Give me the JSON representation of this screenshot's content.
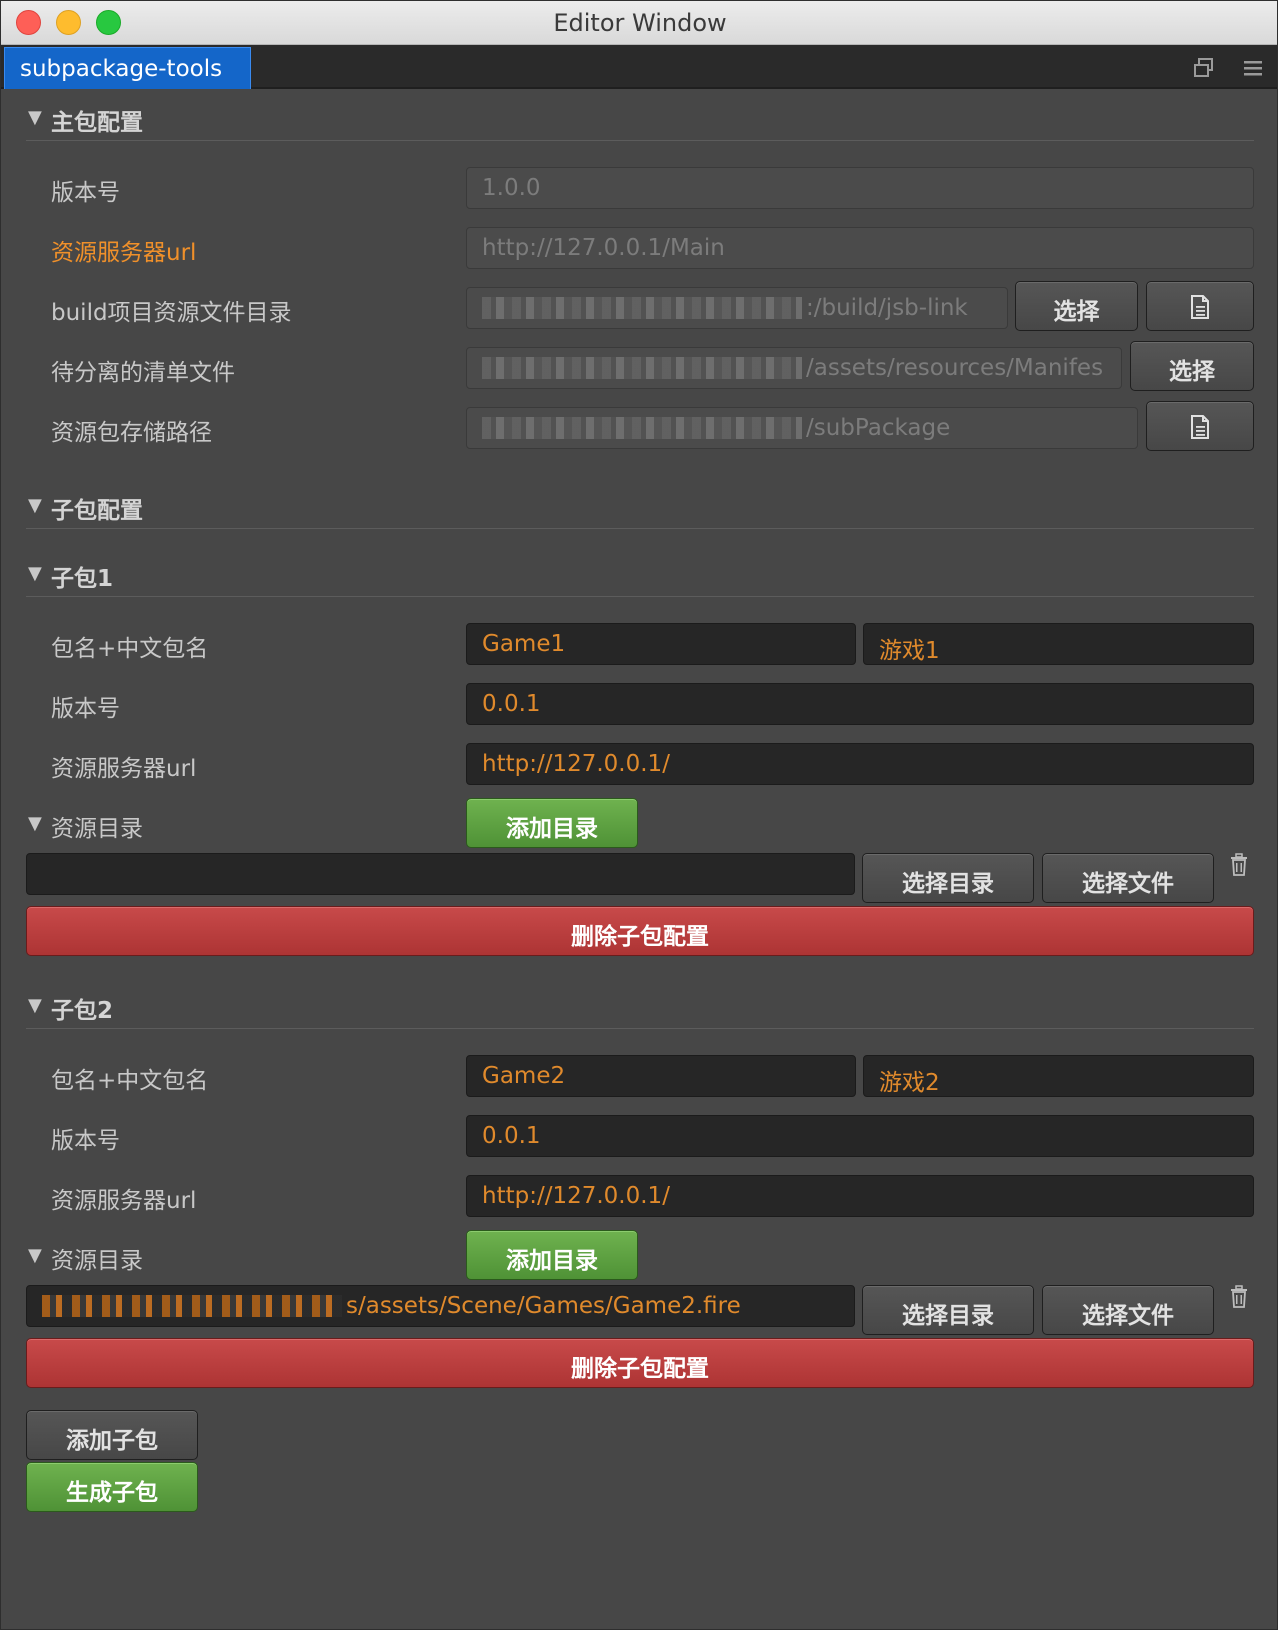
{
  "window": {
    "title": "Editor Window"
  },
  "tabbar": {
    "active_tab": "subpackage-tools",
    "icons": [
      "restore-window-icon",
      "menu-icon"
    ]
  },
  "main_section": {
    "title": "主包配置",
    "version_label": "版本号",
    "version_value": "1.0.0",
    "server_label": "资源服务器url",
    "server_value": "http://127.0.0.1/Main",
    "build_dir_label": "build项目资源文件目录",
    "build_dir_value": ":/build/jsb-link",
    "manifest_label": "待分离的清单文件",
    "manifest_value": "/assets/resources/Manifes",
    "store_label": "资源包存储路径",
    "store_value": "/subPackage",
    "choose_label": "选择"
  },
  "sub_section": {
    "title": "子包配置"
  },
  "subpackages": [
    {
      "title": "子包1",
      "name_label": "包名+中文包名",
      "name": "Game1",
      "cn_name": "游戏1",
      "version_label": "版本号",
      "version": "0.0.1",
      "server_label": "资源服务器url",
      "server": "http://127.0.0.1/",
      "dir_label": "资源目录",
      "add_dir_label": "添加目录",
      "dir_value": "",
      "choose_dir_label": "选择目录",
      "choose_file_label": "选择文件",
      "delete_label": "删除子包配置"
    },
    {
      "title": "子包2",
      "name_label": "包名+中文包名",
      "name": "Game2",
      "cn_name": "游戏2",
      "version_label": "版本号",
      "version": "0.0.1",
      "server_label": "资源服务器url",
      "server": "http://127.0.0.1/",
      "dir_label": "资源目录",
      "add_dir_label": "添加目录",
      "dir_value": "s/assets/Scene/Games/Game2.fire",
      "choose_dir_label": "选择目录",
      "choose_file_label": "选择文件",
      "delete_label": "删除子包配置"
    }
  ],
  "footer": {
    "add_label": "添加子包",
    "generate_label": "生成子包"
  },
  "colors": {
    "accent_orange": "#e08a2c",
    "tab_blue": "#1466c9",
    "green": "#5ea343",
    "red": "#b83c3c"
  }
}
